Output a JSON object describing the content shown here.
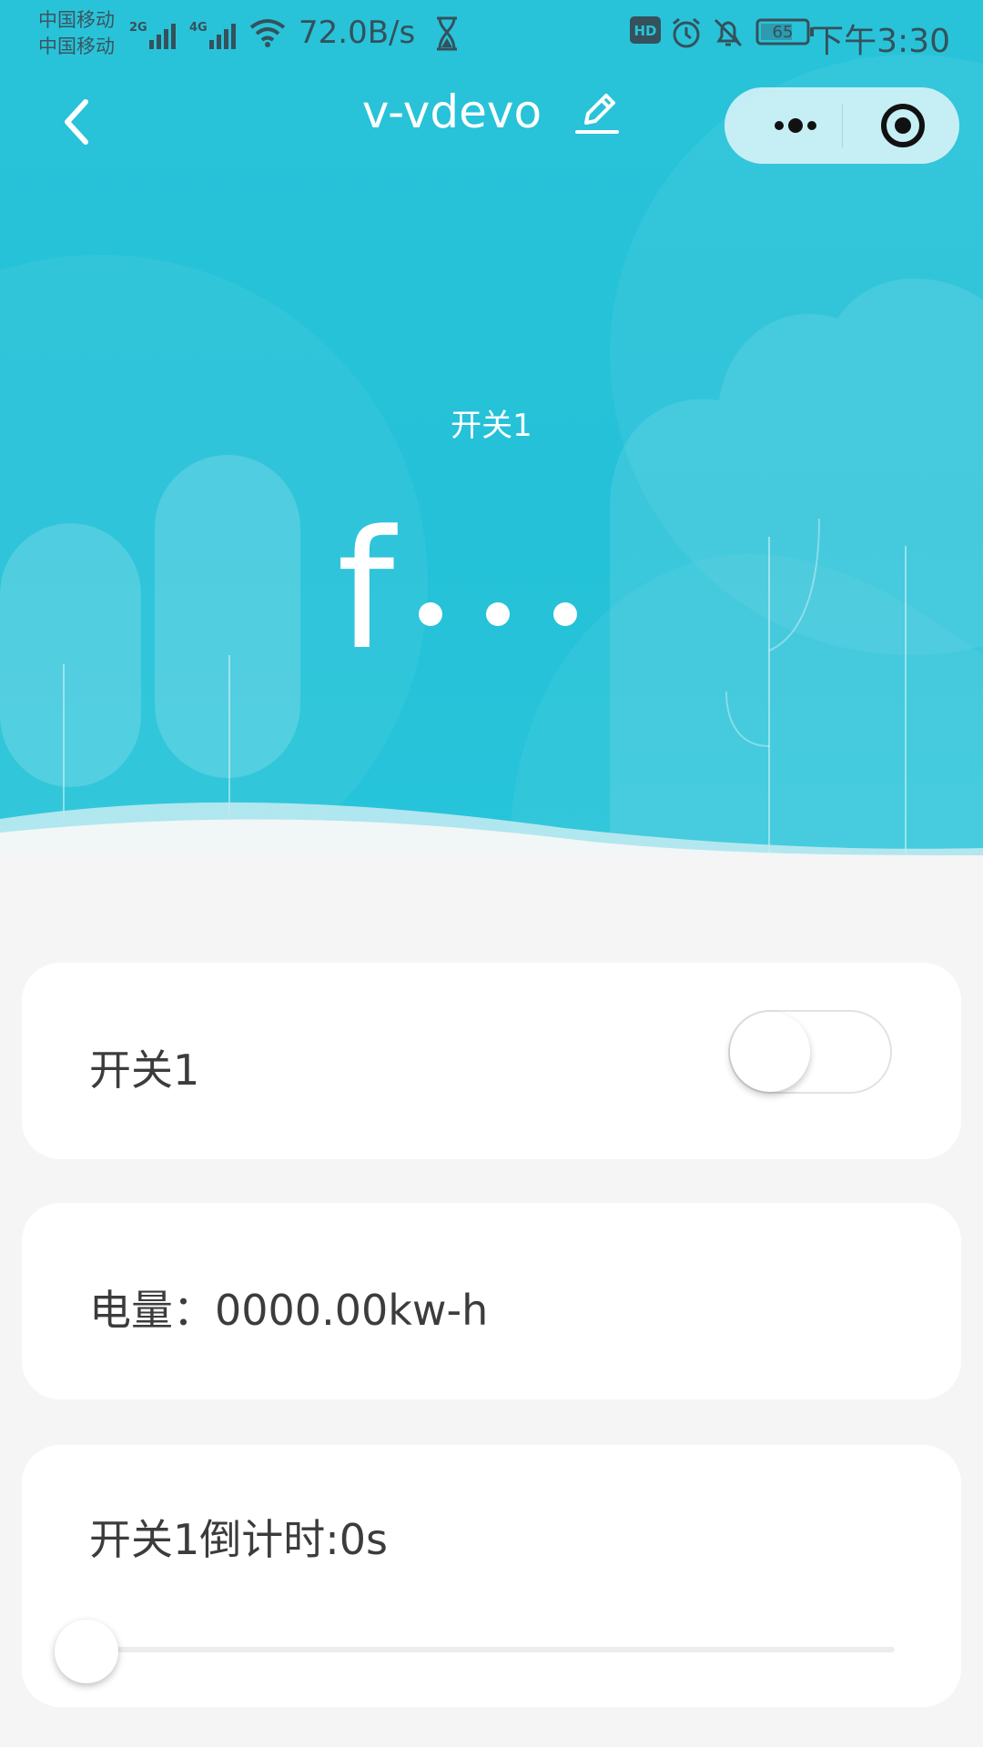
{
  "status_bar": {
    "carrier_1": "中国移动",
    "carrier_2": "中国移动",
    "net_2g": "2G",
    "net_4g": "4G",
    "speed": "72.0B/s",
    "battery": "65",
    "time": "下午3:30",
    "hd": "HD"
  },
  "nav": {
    "title": "v-vdevo"
  },
  "hero": {
    "label": "开关1",
    "value": "f"
  },
  "cards": {
    "switch_label": "开关1",
    "switch_on": false,
    "energy_text": "电量：0000.00kw-h",
    "countdown_text": "开关1倒计时:0s",
    "countdown_level": 0
  },
  "colors": {
    "hero_bg": "#26c2d9",
    "card_bg": "#ffffff",
    "page_bg": "#f5f5f5"
  }
}
